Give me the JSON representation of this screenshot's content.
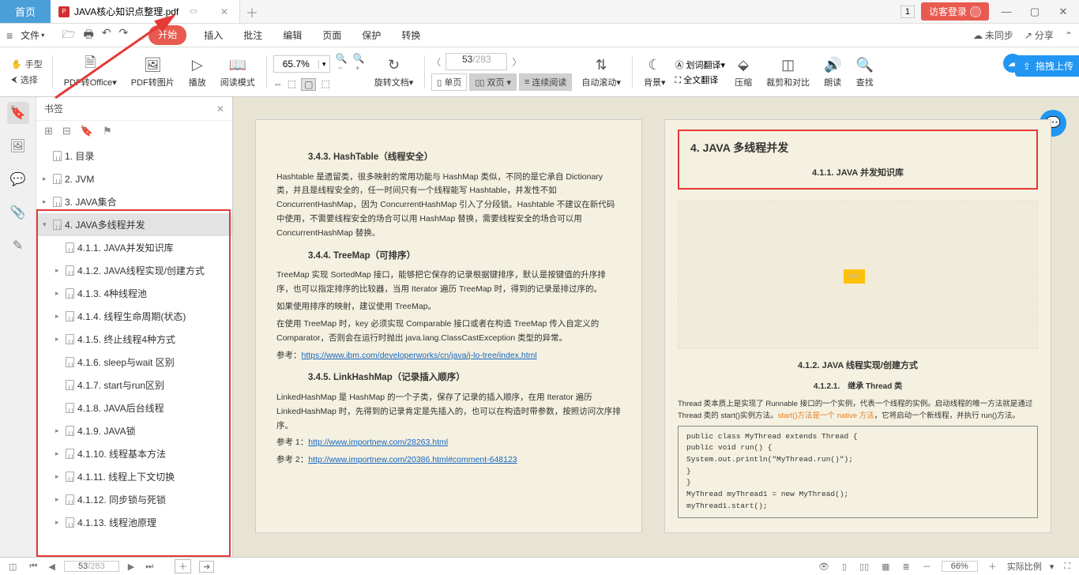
{
  "title": {
    "home": "首页",
    "file": "JAVA核心知识点整理.pdf",
    "badge": "1",
    "login": "访客登录"
  },
  "menu": {
    "file": "文件",
    "tabs": [
      "开始",
      "插入",
      "批注",
      "编辑",
      "页面",
      "保护",
      "转换"
    ],
    "sync": "未同步",
    "share": "分享"
  },
  "ribbon": {
    "hand": "手型",
    "select": "选择",
    "toOffice": "PDF转Office",
    "toImg": "PDF转图片",
    "play": "播放",
    "read": "阅读模式",
    "zoom": "65.7%",
    "rotate": "旋转文档",
    "single": "单页",
    "double": "双页",
    "cont": "连续阅读",
    "autoscroll": "自动滚动",
    "bg": "背景",
    "wordtrans": "划词翻译",
    "fulltrans": "全文翻译",
    "compress": "压缩",
    "crop": "裁剪和对比",
    "readaloud": "朗读",
    "find": "查找",
    "page_cur": "53",
    "page_total": "/283",
    "upload": "拖拽上传"
  },
  "bookmarks": {
    "title": "书签",
    "top": [
      {
        "t": "1. 目录",
        "exp": false
      },
      {
        "t": "2. JVM",
        "exp": true
      },
      {
        "t": "3. JAVA集合",
        "exp": true
      }
    ],
    "sel": "4. JAVA多线程并发",
    "children": [
      {
        "t": "4.1.1. JAVA并发知识库",
        "exp": null
      },
      {
        "t": "4.1.2. JAVA线程实现/创建方式",
        "exp": true
      },
      {
        "t": "4.1.3. 4种线程池",
        "exp": true
      },
      {
        "t": "4.1.4. 线程生命周期(状态)",
        "exp": true
      },
      {
        "t": "4.1.5. 终止线程4种方式",
        "exp": true
      },
      {
        "t": "4.1.6. sleep与wait 区别",
        "exp": null
      },
      {
        "t": "4.1.7. start与run区别",
        "exp": null
      },
      {
        "t": "4.1.8. JAVA后台线程",
        "exp": null
      },
      {
        "t": "4.1.9. JAVA锁",
        "exp": true
      },
      {
        "t": "4.1.10. 线程基本方法",
        "exp": true
      },
      {
        "t": "4.1.11. 线程上下文切换",
        "exp": true
      },
      {
        "t": "4.1.12. 同步锁与死锁",
        "exp": true
      },
      {
        "t": "4.1.13. 线程池原理",
        "exp": true
      }
    ]
  },
  "pageL": {
    "h1": "3.4.3. HashTable（线程安全）",
    "p1": "Hashtable 是遗留类，很多映射的常用功能与 HashMap 类似，不同的是它承自 Dictionary 类，并且是线程安全的，任一时间只有一个线程能写 Hashtable，并发性不如 ConcurrentHashMap，因为 ConcurrentHashMap 引入了分段锁。Hashtable 不建议在新代码中使用，不需要线程安全的场合可以用 HashMap 替换，需要线程安全的场合可以用 ConcurrentHashMap 替换。",
    "h2": "3.4.4. TreeMap（可排序）",
    "p2": "TreeMap 实现 SortedMap 接口，能够把它保存的记录根据键排序，默认是按键值的升序排序，也可以指定排序的比较器，当用 Iterator 遍历 TreeMap 时，得到的记录是排过序的。",
    "p3": "如果使用排序的映射，建议使用 TreeMap。",
    "p4": "在使用 TreeMap 时，key 必须实现 Comparable 接口或者在构造 TreeMap 传入自定义的Comparator，否则会在运行时抛出 java.lang.ClassCastException 类型的异常。",
    "ref1": "参考：",
    "link1": "https://www.ibm.com/developerworks/cn/java/j-lo-tree/index.html",
    "h3": "3.4.5. LinkHashMap（记录插入顺序）",
    "p5": "LinkedHashMap 是 HashMap 的一个子类，保存了记录的插入顺序，在用 Iterator 遍历LinkedHashMap 时，先得到的记录肯定是先插入的，也可以在构造时带参数，按照访问次序排序。",
    "ref2": "参考 1：",
    "link2": "http://www.importnew.com/28263.html",
    "ref3": "参考 2：",
    "link3": "http://www.importnew.com/20386.html#comment-648123"
  },
  "pageR": {
    "title": "4. JAVA 多线程并发",
    "sub1": "4.1.1. JAVA 并发知识库",
    "mm": "JUC",
    "sub2": "4.1.2. JAVA 线程实现/创建方式",
    "sub3": "4.1.2.1.　继承 Thread 类",
    "p1a": "Thread 类本质上是实现了 Runnable 接口的一个实例，代表一个线程的实例。启动线程的唯一方法就是通过 Thread 类的 start()实例方法。",
    "p1b": "start()方法是一个 native 方法",
    "p1c": "，它将启动一个新线程，并执行 run()方法。",
    "c1": "public class MyThread extends Thread {",
    "c2": "    public void run() {",
    "c3": "      System.out.println(\"MyThread.run()\");",
    "c4": "   }",
    "c5": "}",
    "c6": "MyThread myThread1 = new MyThread();",
    "c7": "myThread1.start();"
  },
  "status": {
    "cur": "53",
    "tot": "/283",
    "zoom": "66%",
    "scale": "实际比例"
  }
}
